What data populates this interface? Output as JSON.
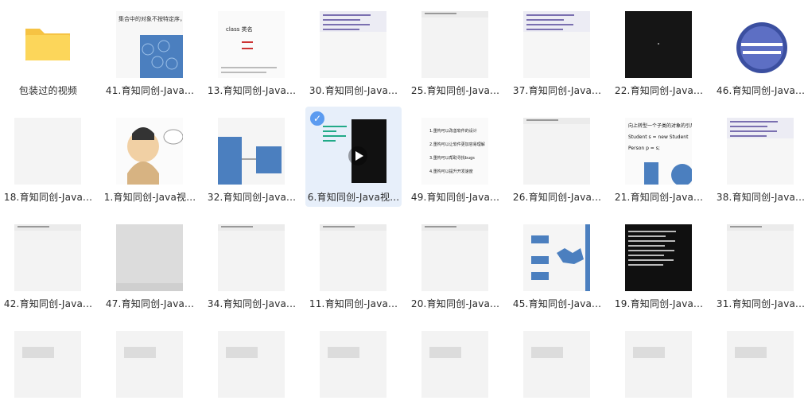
{
  "files": [
    {
      "name": "包装过的视频",
      "type": "folder"
    },
    {
      "name": "41.育知同创-Java...",
      "type": "text-slide",
      "text": "集合中的对象不按特定序，并且没有重复"
    },
    {
      "name": "13.育知同创-Java...",
      "type": "class-slide",
      "text": "class 类名"
    },
    {
      "name": "30.育知同创-Java...",
      "type": "code"
    },
    {
      "name": "25.育知同创-Java...",
      "type": "blank-code"
    },
    {
      "name": "37.育知同创-Java...",
      "type": "code"
    },
    {
      "name": "22.育知同创-Java...",
      "type": "dark"
    },
    {
      "name": "46.育知同创-Java...",
      "type": "eclipse"
    },
    {
      "name": "18.育知同创-Java...",
      "type": "blank"
    },
    {
      "name": "1.育知同创-Java视...",
      "type": "portrait"
    },
    {
      "name": "32.育知同创-Java...",
      "type": "diagram"
    },
    {
      "name": "6.育知同创-Java视...",
      "type": "terminal",
      "selected": true
    },
    {
      "name": "49.育知同创-Java...",
      "type": "list",
      "items": [
        "1.重构可以改善软件的设计",
        "2.重构可以让软件更加容易理解",
        "3.重构可以帮助寻找bugs",
        "4.重构可以提升开发速度"
      ]
    },
    {
      "name": "26.育知同创-Java...",
      "type": "blank-code"
    },
    {
      "name": "21.育知同创-Java...",
      "type": "upcast",
      "lines": [
        "向上转型一个子类的对象的引用：",
        "Student s = new Student",
        "Person p = s;"
      ]
    },
    {
      "name": "38.育知同创-Java...",
      "type": "code"
    },
    {
      "name": "42.育知同创-Java...",
      "type": "blank-code"
    },
    {
      "name": "47.育知同创-Java...",
      "type": "gray"
    },
    {
      "name": "34.育知同创-Java...",
      "type": "blank-code"
    },
    {
      "name": "11.育知同创-Java...",
      "type": "blank-code"
    },
    {
      "name": "20.育知同创-Java...",
      "type": "blank-code"
    },
    {
      "name": "45.育知同创-Java...",
      "type": "blue-diagram"
    },
    {
      "name": "19.育知同创-Java...",
      "type": "console"
    },
    {
      "name": "31.育知同创-Java...",
      "type": "blank-code"
    },
    {
      "name": "",
      "type": "partial"
    },
    {
      "name": "",
      "type": "partial"
    },
    {
      "name": "",
      "type": "partial"
    },
    {
      "name": "",
      "type": "partial"
    },
    {
      "name": "",
      "type": "partial"
    },
    {
      "name": "",
      "type": "partial"
    },
    {
      "name": "",
      "type": "partial"
    },
    {
      "name": "",
      "type": "partial"
    }
  ],
  "colors": {
    "folder": "#fcd65a",
    "folder_tab": "#f6c343",
    "selected_bg": "#e7effa",
    "check": "#5b9bf0"
  }
}
